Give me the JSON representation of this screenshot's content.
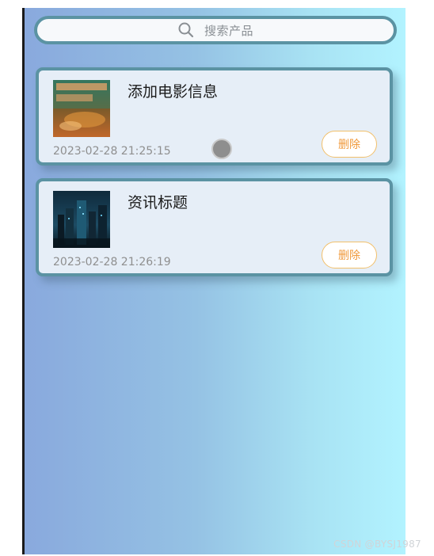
{
  "search": {
    "icon": "search-icon",
    "placeholder": "搜索产品"
  },
  "items": [
    {
      "title": "添加电影信息",
      "time": "2023-02-28 21:25:15",
      "delete_label": "删除",
      "thumbnail": "movie-poster-thumbnail"
    },
    {
      "title": "资讯标题",
      "time": "2023-02-28 21:26:19",
      "delete_label": "删除",
      "thumbnail": "night-city-thumbnail"
    }
  ],
  "watermark": "CSDN @BYSJ1987",
  "colors": {
    "border": "#5b93a3",
    "card_bg": "#e6eef7",
    "delete_text": "#f09a3c",
    "delete_border": "#f2c06b",
    "gradient_start": "#89a9dd",
    "gradient_end": "#b2f3ff"
  }
}
